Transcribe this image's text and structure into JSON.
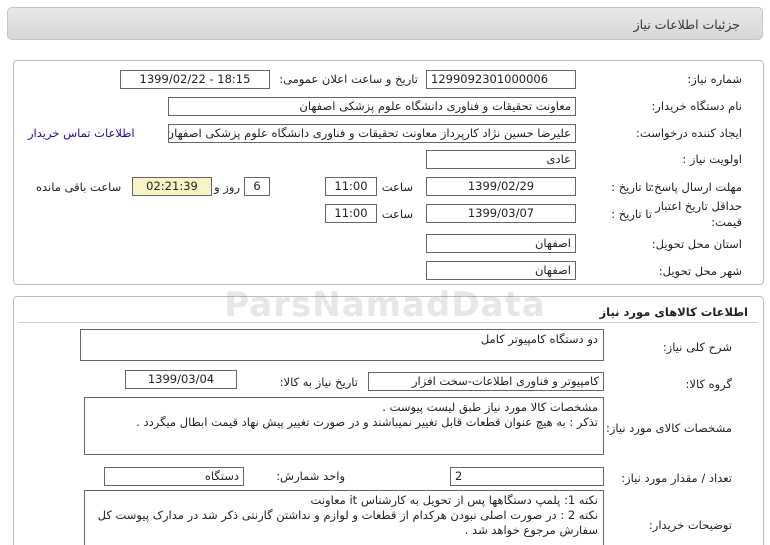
{
  "header": {
    "title": "جزئیات اطلاعات نیاز"
  },
  "need": {
    "number_label": "شماره نیاز:",
    "number": "1299092301000006",
    "announce_label": "تاریخ و ساعت اعلان عمومی:",
    "announce": "1399/02/22 - 18:15",
    "buyer_label": "نام دستگاه خریدار:",
    "buyer": "معاونت تحقیقات و فناوری دانشگاه علوم پزشکی اصفهان",
    "creator_label": "ایجاد کننده درخواست:",
    "creator": "علیرضا حسین نژاد کارپرداز معاونت تحقیقات و فناوری دانشگاه علوم پزشکی اصفهان",
    "contact_link": "اطلاعات تماس خریدار",
    "priority_label": "اولویت نیاز :",
    "priority": "عادی",
    "reply_label": "مهلت ارسال پاسخ:",
    "to_date_label": "تا تاریخ :",
    "reply_date": "1399/02/29",
    "time_label": "ساعت",
    "reply_time": "11:00",
    "days": "6",
    "days_label": "روز و",
    "remaining": "02:21:39",
    "remaining_label": "ساعت باقی مانده",
    "validity_label": "حداقل تاریخ اعتبار قیمت:",
    "validity_date": "1399/03/07",
    "validity_time": "11:00",
    "province_label": "استان محل تحویل:",
    "province": "اصفهان",
    "city_label": "شهر محل تحویل:",
    "city": "اصفهان"
  },
  "goods": {
    "section_title": "اطلاعات کالاهای مورد نیاز",
    "summary_label": "شرح کلی نیاز:",
    "summary": "دو دستگاه کامپیوتر کامل",
    "group_label": "گروه کالا:",
    "group": "کامپیوتر و فناوری اطلاعات-سخت افزار",
    "need_date_label": "تاریخ نیاز به کالا:",
    "need_date": "1399/03/04",
    "spec_label": "مشخصات کالای مورد نیاز:",
    "spec_line1": "مشخصات کالا مورد نیاز طبق لیست پیوست .",
    "spec_line2": "تذکر : به هیچ عنوان قطعات قابل تغییر نمیباشند و در صورت تغییر  پیش نهاد قیمت ابطال میگردد .",
    "qty_label": "تعداد / مقدار مورد نیاز:",
    "qty": "2",
    "unit_label": "واحد شمارش:",
    "unit": "دستگاه",
    "notes_label": "توضیحات خریدار:",
    "note1": "نکته 1: پلمپ دستگاهها پس از تحویل به کارشناس it  معاونت",
    "note2": "نکته 2 : در صورت اصلی نبودن هرکدام از قطعات و لوازم و نداشتن گارنتی ذکر شد در مدارک پیوست کل سفارش مرجوع خواهد شد ."
  },
  "watermark": "ParsNamadData",
  "colors": {
    "header_bg": "#dcdcdc",
    "link": "#1a0dab",
    "timer_bg": "#f7f3c4"
  }
}
